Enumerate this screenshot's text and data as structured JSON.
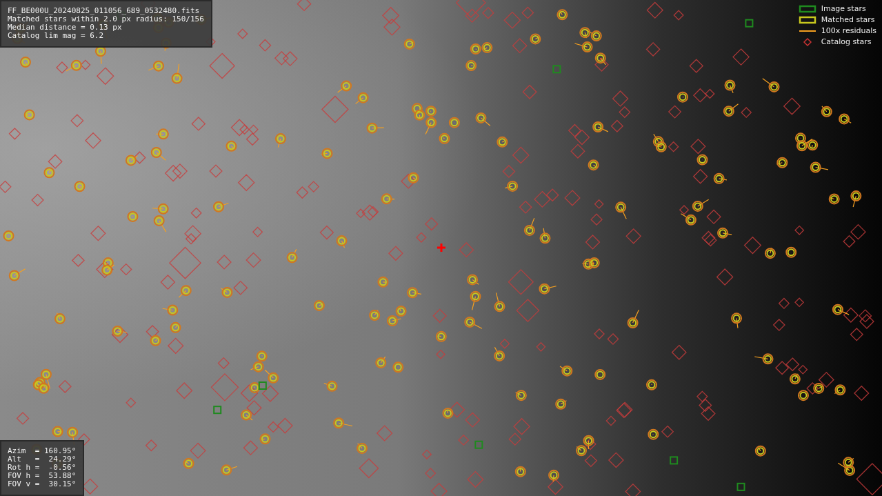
{
  "info_panel": {
    "lines": [
      "FF_BE000U_20240825_011056_689_0532480.fits",
      "Matched stars within 2.0 px radius: 150/156",
      "Median distance = 0.13 px",
      "Catalog lim mag = 6.2"
    ]
  },
  "legend": [
    {
      "label": "Image stars",
      "kind": "box",
      "color": "#1f8a1f"
    },
    {
      "label": "Matched stars",
      "kind": "box",
      "color": "#c8c81e"
    },
    {
      "label": "100x residuals",
      "kind": "line",
      "color": "#f5a020"
    },
    {
      "label": "Catalog stars",
      "kind": "diamond",
      "color": "#c83232"
    }
  ],
  "pointing_panel": {
    "lines": [
      "Azim  = 160.95°",
      "Alt   =  24.29°",
      "Rot h =  -0.56°",
      "FOV h =  53.88°",
      "FOV v =  30.15°"
    ]
  }
}
